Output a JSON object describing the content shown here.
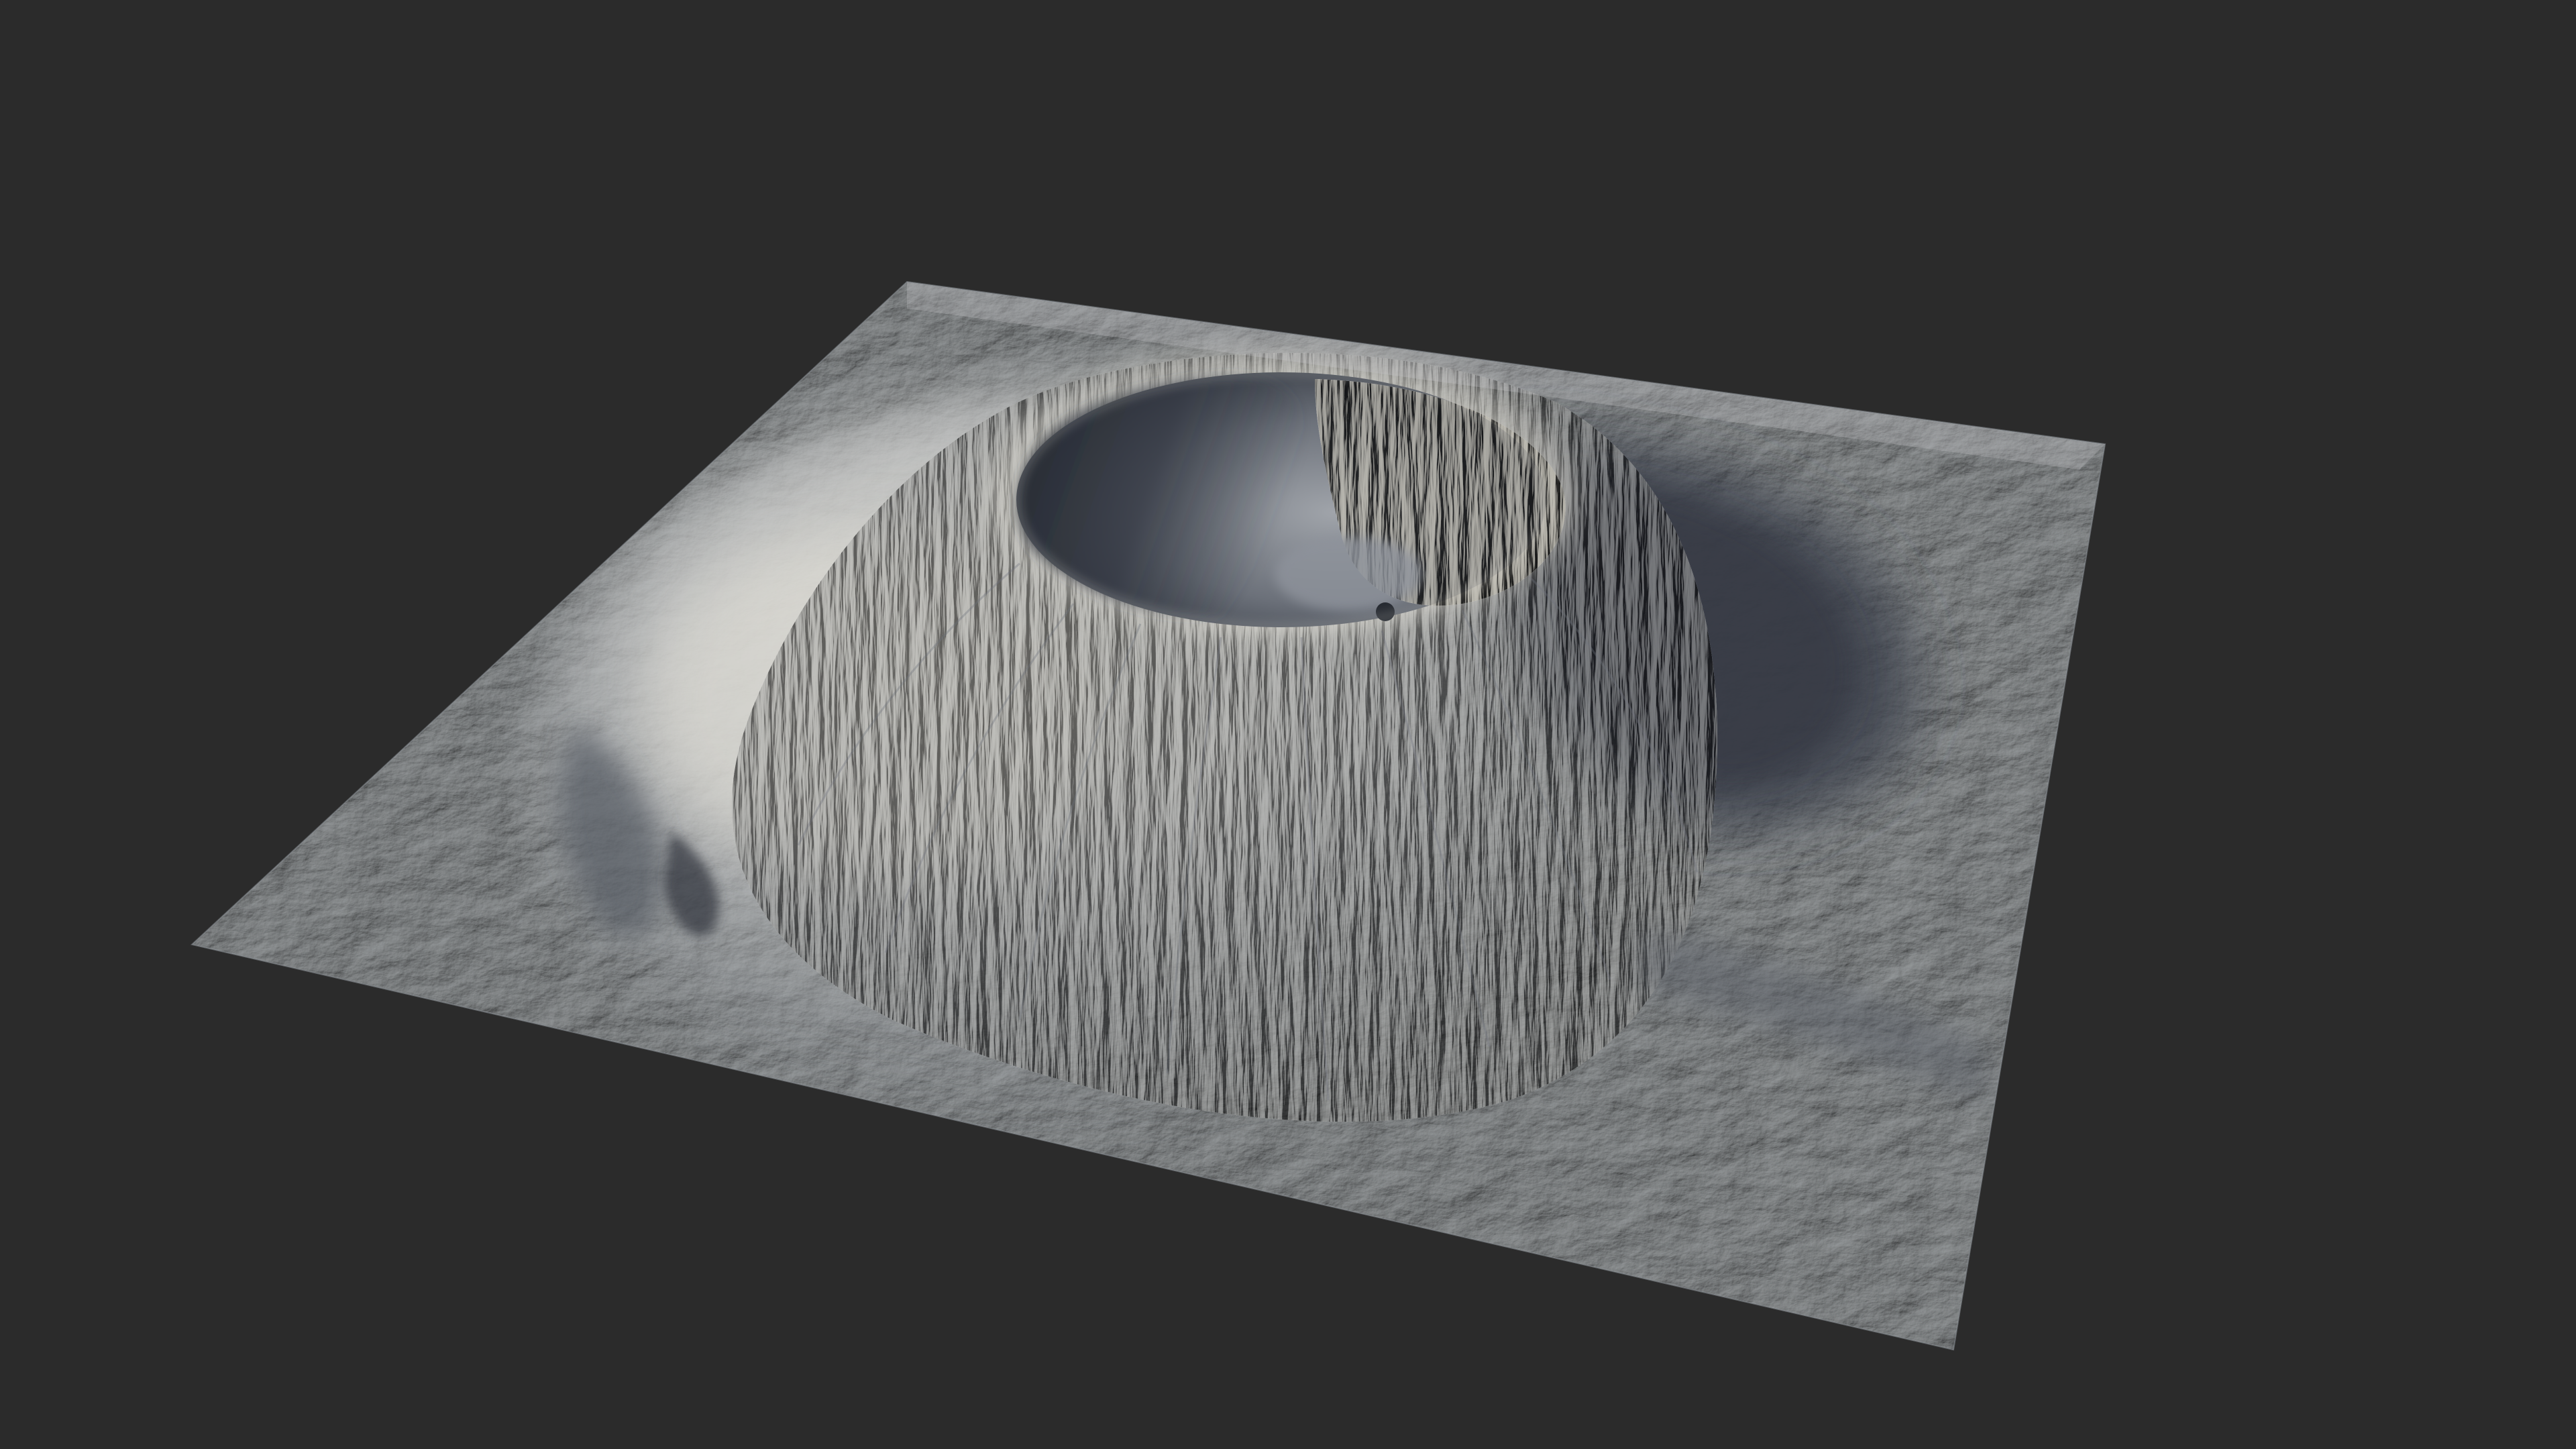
{
  "scene": {
    "background_color": "#2b2b2b",
    "subject": "volcano-terrain-heightmap-render",
    "terrain": {
      "base_color": "#a9adb3",
      "light_color": "#dcdcd6",
      "shadow_color": "#3a3f49",
      "deep_shadow_color": "#262a31",
      "crater_floor_color": "#8a8f98",
      "warm_highlight_color": "#e6e2d6"
    }
  }
}
